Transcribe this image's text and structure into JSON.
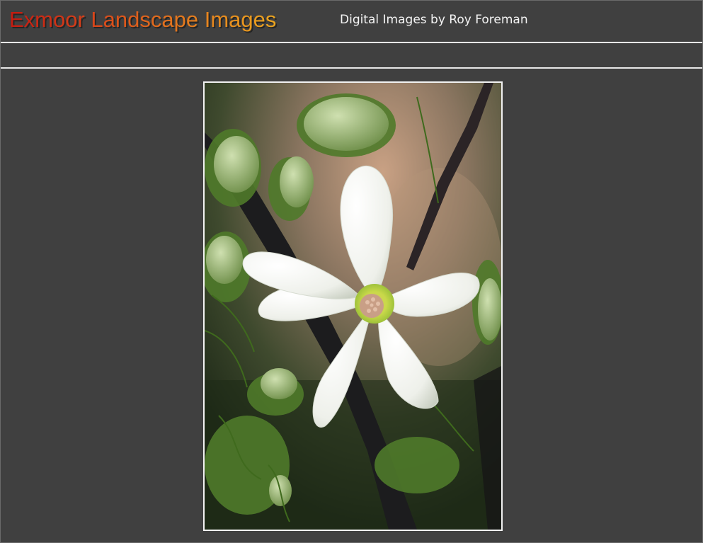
{
  "header": {
    "site_title": "Exmoor Landscape Images",
    "subtitle": "Digital Images by Roy Foreman"
  },
  "photo": {
    "subject": "white-clematis-flower-photo"
  },
  "colors": {
    "background": "#404040",
    "divider": "#e8e8e8",
    "title_gradient_start": "#c41a10",
    "title_gradient_end": "#eba51f",
    "subtitle_text": "#f4f4f4"
  }
}
